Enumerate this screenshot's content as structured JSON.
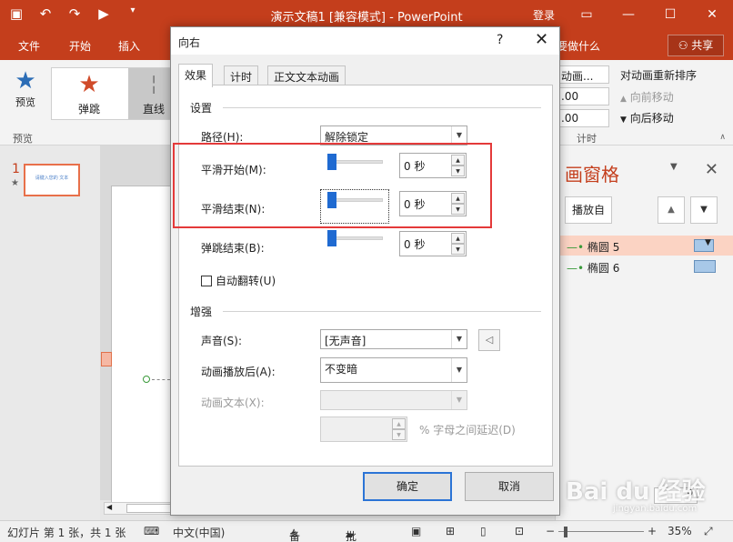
{
  "titlebar": {
    "title": "演示文稿1 [兼容模式] - PowerPoint",
    "login": "登录",
    "qat_icons": [
      "save-icon",
      "undo-icon",
      "redo-icon",
      "start-from-beginning-icon",
      "customize-qat-icon"
    ]
  },
  "tabs": {
    "items": [
      "文件",
      "开始",
      "插入"
    ],
    "tell_me": "要做什么",
    "share": "共享"
  },
  "ribbon": {
    "preview": "预览",
    "preview_group": "预览",
    "anim_items": [
      "弹跳",
      "直线"
    ],
    "timing_values": [
      "动画...",
      ".00",
      ".00"
    ],
    "timing_group": "计时",
    "reorder_title": "对动画重新排序",
    "move_earlier": "向前移动",
    "move_later": "向后移动"
  },
  "slides_pane": {
    "slide_number": "1",
    "thumb_text": "请键入您的 文本"
  },
  "anim_pane": {
    "title": "画窗格",
    "play_from": "播放自",
    "items": [
      {
        "name": "椭圆 5",
        "selected": true
      },
      {
        "name": "椭圆 6",
        "selected": false
      }
    ]
  },
  "status": {
    "slide_info": "幻灯片 第 1 张，共 1 张",
    "language": "中文(中国)",
    "notes": "备注",
    "comments": "批注",
    "zoom": "35%"
  },
  "dialog": {
    "title": "向右",
    "help": "?",
    "tabs": [
      "效果",
      "计时",
      "正文文本动画"
    ],
    "settings_header": "设置",
    "path_label": "路径(H):",
    "path_value": "解除锁定",
    "smooth_start_label": "平滑开始(M):",
    "smooth_start_value": "0 秒",
    "smooth_end_label": "平滑结束(N):",
    "smooth_end_value": "0 秒",
    "bounce_end_label": "弹跳结束(B):",
    "bounce_end_value": "0 秒",
    "auto_reverse_label": "自动翻转(U)",
    "enhance_header": "增强",
    "sound_label": "声音(S):",
    "sound_value": "[无声音]",
    "after_anim_label": "动画播放后(A):",
    "after_anim_value": "不变暗",
    "anim_text_label": "动画文本(X):",
    "anim_text_value": "",
    "delay_label": "% 字母之间延迟(D)",
    "ok": "确定",
    "cancel": "取消"
  },
  "watermark": {
    "brand": "Bai du 经验",
    "url": "jingyan.baidu.com"
  },
  "colors": {
    "accent": "#c43e1c",
    "highlight": "#e43a3a",
    "slider_thumb": "#1f6ad1"
  }
}
